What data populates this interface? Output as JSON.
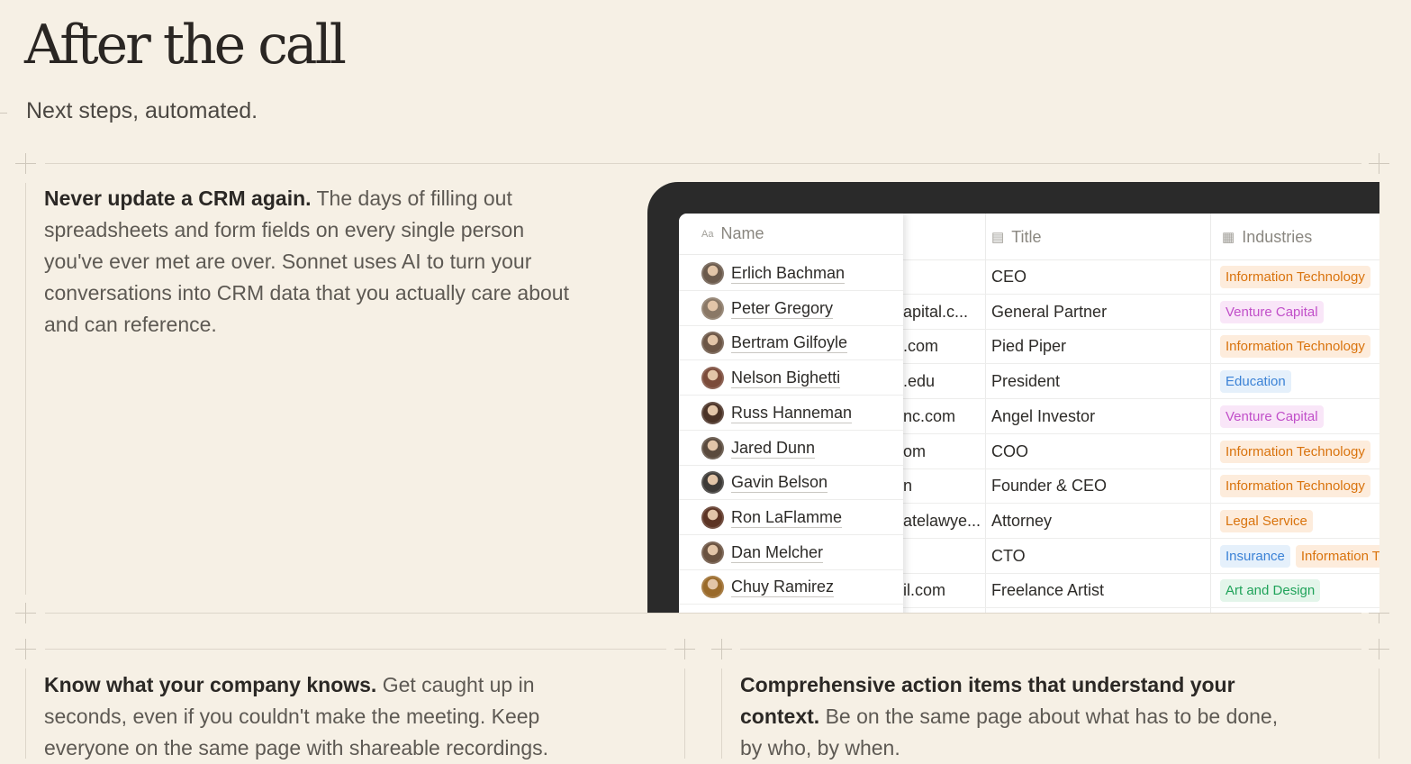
{
  "header": {
    "title": "After the call",
    "subtitle": "Next steps, automated."
  },
  "features": {
    "crm": {
      "heading": "Never update a CRM again.",
      "body": " The days of filling out spreadsheets and form fields on every single person you've ever met are over. Sonnet uses AI to turn your conversations into CRM data that you actually care about and can reference."
    },
    "company": {
      "heading": "Know what your company knows.",
      "body": " Get caught up in seconds, even if you couldn't make the meeting. Keep everyone on the same page with shareable recordings."
    },
    "actions": {
      "heading": "Comprehensive action items that understand your context.",
      "body": " Be on the same page about what has to be done, by who, by when."
    }
  },
  "crm_table": {
    "columns": {
      "name": "Name",
      "title": "Title",
      "industries": "Industries",
      "name_icon": "text-property-icon",
      "title_icon": "id-card-icon",
      "industries_icon": "building-icon"
    },
    "rows": [
      {
        "name": "Erlich Bachman",
        "email": "",
        "title": "CEO",
        "industries": [
          "Information Technology"
        ]
      },
      {
        "name": "Peter Gregory",
        "email": "apital.c...",
        "title": "General Partner",
        "industries": [
          "Venture Capital"
        ]
      },
      {
        "name": "Bertram Gilfoyle",
        "email": ".com",
        "title": "Pied Piper",
        "industries": [
          "Information Technology"
        ]
      },
      {
        "name": "Nelson Bighetti",
        "email": ".edu",
        "title": "President",
        "industries": [
          "Education"
        ]
      },
      {
        "name": "Russ Hanneman",
        "email": "nc.com",
        "title": "Angel Investor",
        "industries": [
          "Venture Capital"
        ]
      },
      {
        "name": "Jared Dunn",
        "email": "om",
        "title": "COO",
        "industries": [
          "Information Technology"
        ]
      },
      {
        "name": "Gavin Belson",
        "email": "n",
        "title": "Founder & CEO",
        "industries": [
          "Information Technology"
        ]
      },
      {
        "name": "Ron LaFlamme",
        "email": "atelawye...",
        "title": "Attorney",
        "industries": [
          "Legal Service"
        ]
      },
      {
        "name": "Dan Melcher",
        "email": "",
        "title": "CTO",
        "industries": [
          "Insurance",
          "Information T"
        ]
      },
      {
        "name": "Chuy Ramirez",
        "email": "il.com",
        "title": "Freelance Artist",
        "industries": [
          "Art and Design"
        ]
      }
    ],
    "tag_colors": {
      "Information Technology": {
        "bg": "#fdecdc",
        "fg": "#d9730d"
      },
      "Information T": {
        "bg": "#fdecdc",
        "fg": "#d9730d"
      },
      "Venture Capital": {
        "bg": "#f9e6f8",
        "fg": "#c14fc9"
      },
      "Education": {
        "bg": "#e5f0fb",
        "fg": "#3b82d6"
      },
      "Legal Service": {
        "bg": "#fdecdc",
        "fg": "#d9730d"
      },
      "Insurance": {
        "bg": "#e5f0fb",
        "fg": "#3b82d6"
      },
      "Art and Design": {
        "bg": "#e3f5ea",
        "fg": "#20a35a"
      }
    },
    "avatar_colors": [
      "#6b5a4c",
      "#8a7866",
      "#6c5646",
      "#7b4b3a",
      "#4a3226",
      "#5a4a3d",
      "#3d3a37",
      "#5c3424",
      "#6a5240",
      "#9a6a2a"
    ]
  }
}
